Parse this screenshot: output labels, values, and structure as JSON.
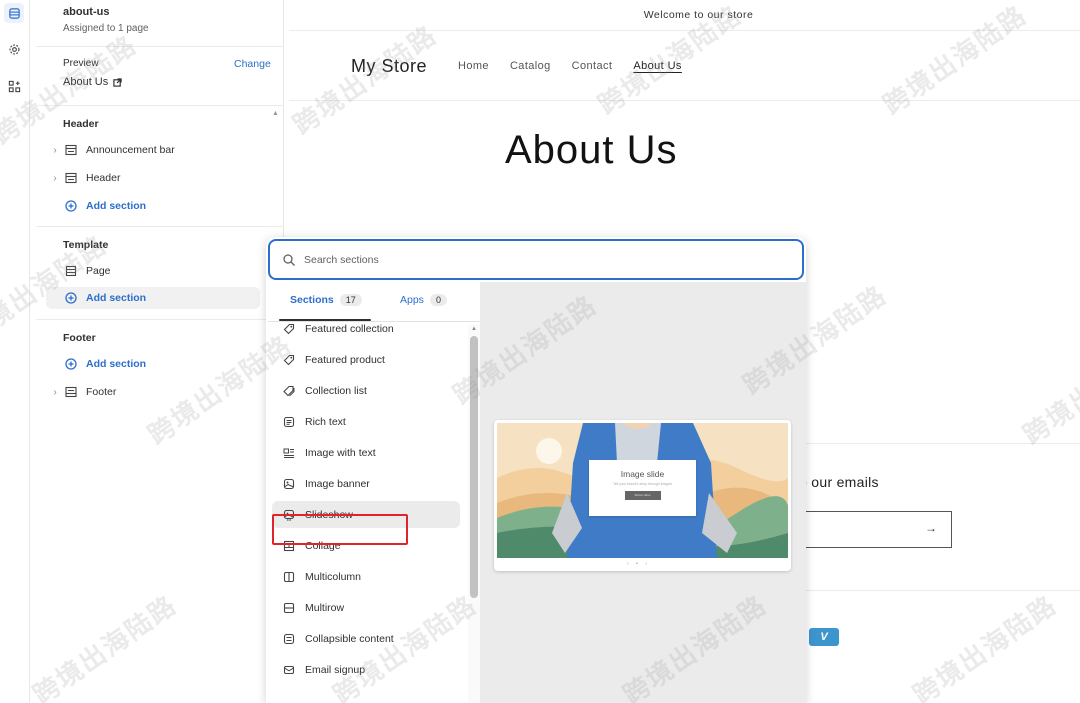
{
  "rail": {
    "icons": [
      "sections-icon",
      "settings-gear-icon",
      "apps-icon"
    ]
  },
  "editor": {
    "template_name": "about-us",
    "assigned": "Assigned to 1 page",
    "preview_label": "Preview",
    "preview_change": "Change",
    "preview_value": "About Us",
    "groups": {
      "header": {
        "label": "Header",
        "items": [
          "Announcement bar",
          "Header"
        ],
        "add": "Add section"
      },
      "template": {
        "label": "Template",
        "items": [
          "Page"
        ],
        "add": "Add section"
      },
      "footer": {
        "label": "Footer",
        "add": "Add section",
        "items": [
          "Footer"
        ]
      }
    }
  },
  "store": {
    "announcement": "Welcome to our store",
    "logo": "My Store",
    "nav": [
      "Home",
      "Catalog",
      "Contact",
      "About Us"
    ],
    "active_nav": "About Us",
    "page_title": "About Us",
    "newsletter_text": "o our emails",
    "newsletter_arrow": "→",
    "payment_icon": "V"
  },
  "picker": {
    "search_placeholder": "Search sections",
    "tabs": [
      {
        "label": "Sections",
        "count": "17"
      },
      {
        "label": "Apps",
        "count": "0"
      }
    ],
    "sections": [
      {
        "label": "Featured collection",
        "icon": "tag-icon"
      },
      {
        "label": "Featured product",
        "icon": "tag-icon"
      },
      {
        "label": "Collection list",
        "icon": "tags-icon"
      },
      {
        "label": "Rich text",
        "icon": "text-block-icon"
      },
      {
        "label": "Image with text",
        "icon": "image-text-icon"
      },
      {
        "label": "Image banner",
        "icon": "image-icon"
      },
      {
        "label": "Slideshow",
        "icon": "slideshow-icon"
      },
      {
        "label": "Collage",
        "icon": "collage-icon"
      },
      {
        "label": "Multicolumn",
        "icon": "columns-icon"
      },
      {
        "label": "Multirow",
        "icon": "rows-icon"
      },
      {
        "label": "Collapsible content",
        "icon": "collapsible-icon"
      },
      {
        "label": "Email signup",
        "icon": "email-icon"
      }
    ],
    "highlighted": "Slideshow",
    "preview": {
      "title": "Image slide",
      "subtitle": "Tell your brand's story through images",
      "button": "Button label"
    }
  },
  "watermark": "跨境出海陆路",
  "colors": {
    "accent": "#2c6ecb",
    "highlight_box": "#e0242b"
  }
}
